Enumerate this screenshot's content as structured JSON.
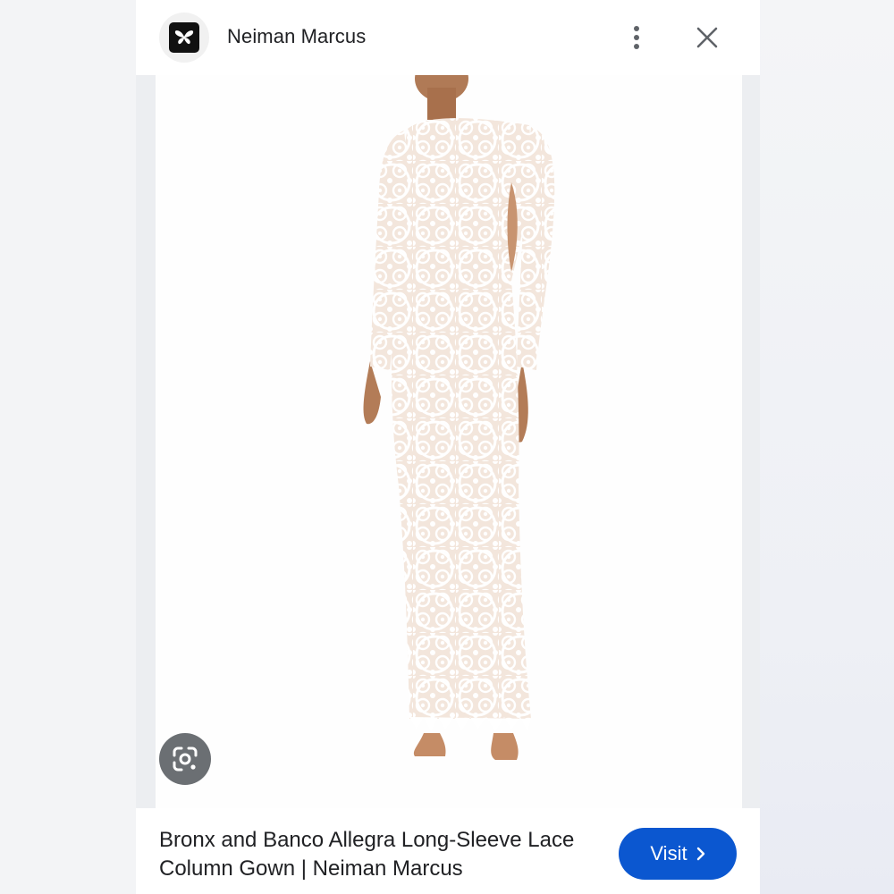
{
  "header": {
    "site_name": "Neiman Marcus",
    "logo_icon": "butterfly-logo-icon",
    "menu_icon": "more-vert-icon",
    "close_icon": "close-icon"
  },
  "image": {
    "subject": "model wearing long-sleeve white lace column gown",
    "lens_icon": "google-lens-icon"
  },
  "footer": {
    "title": "Bronx and Banco Allegra Long-Sleeve Lace Column Gown | Neiman Marcus",
    "visit_label": "Visit",
    "visit_icon": "chevron-right-icon"
  },
  "colors": {
    "accent": "#0b57d0",
    "lens_button": "#5f6368",
    "text": "#202124"
  }
}
